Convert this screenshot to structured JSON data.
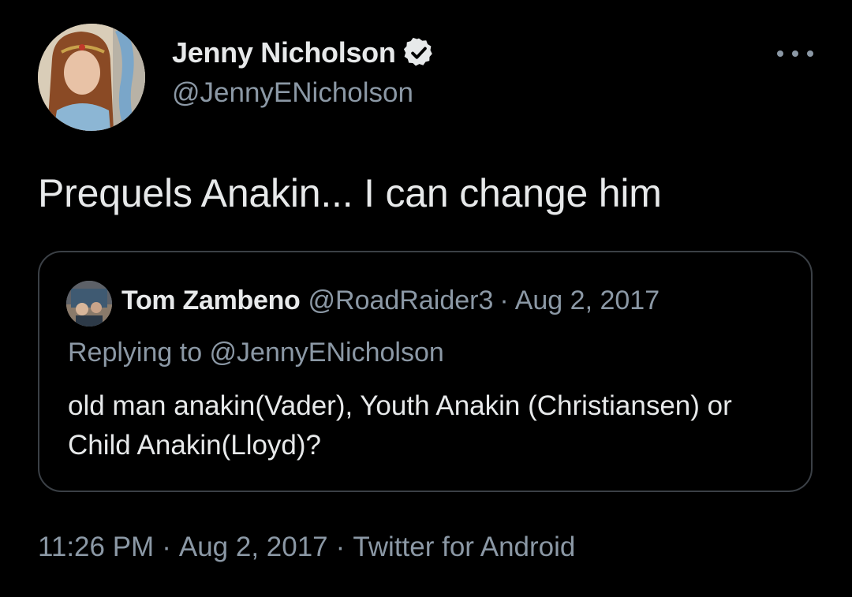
{
  "tweet": {
    "author": {
      "display_name": "Jenny Nicholson",
      "handle": "@JennyENicholson",
      "verified_icon": "verified-badge-icon",
      "avatar_icon": "profile-photo"
    },
    "more_icon": "more-options-icon",
    "text": "Prequels Anakin... I can change him",
    "quoted": {
      "display_name": "Tom Zambeno",
      "handle": "@RoadRaider3",
      "separator": "·",
      "date": "Aug 2, 2017",
      "replying_to": "Replying to @JennyENicholson",
      "text": "old man anakin(Vader), Youth Anakin (Christiansen) or Child Anakin(Lloyd)?"
    },
    "meta": {
      "time": "11:26 PM",
      "date": "Aug 2, 2017",
      "source": "Twitter for Android",
      "separator": "·"
    },
    "colors": {
      "background": "#000000",
      "primary_text": "#e7e9ea",
      "secondary_text": "#8b98a5",
      "border": "#3b4046"
    }
  }
}
